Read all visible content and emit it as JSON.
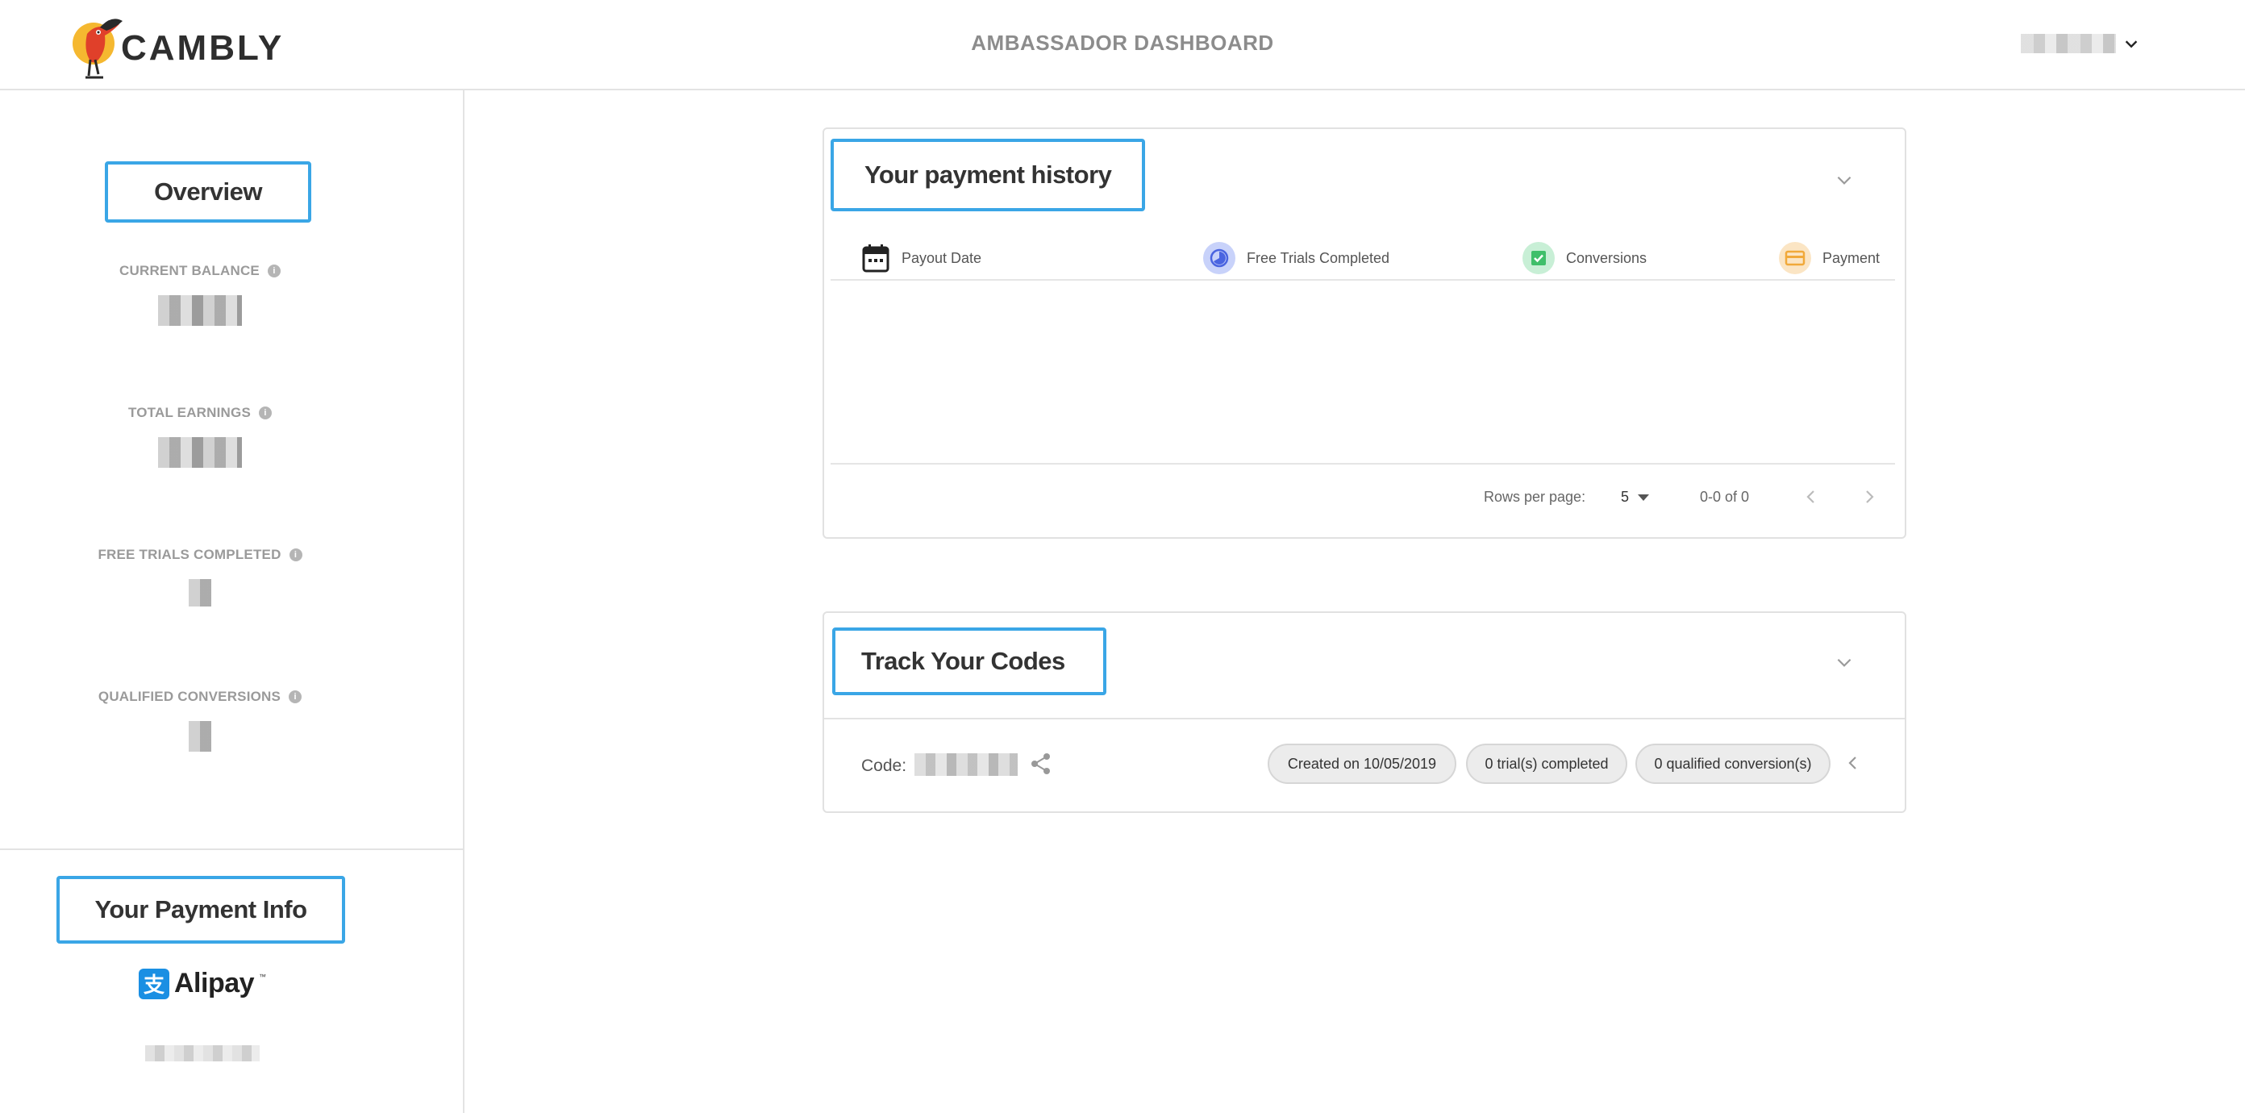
{
  "header": {
    "brand": "CAMBLY",
    "title": "AMBASSADOR DASHBOARD",
    "user_menu_icon": "chevron-down-icon"
  },
  "sidebar": {
    "overview_title": "Overview",
    "stats": [
      {
        "label": "CURRENT BALANCE",
        "icon": "info-icon"
      },
      {
        "label": "TOTAL EARNINGS",
        "icon": "info-icon"
      },
      {
        "label": "FREE TRIALS COMPLETED",
        "icon": "info-icon"
      },
      {
        "label": "QUALIFIED CONVERSIONS",
        "icon": "info-icon"
      }
    ],
    "payment_info_title": "Your Payment Info",
    "payment_method": "Alipay",
    "payment_method_tm": "™"
  },
  "payment_history": {
    "title": "Your payment history",
    "columns": [
      {
        "label": "Payout Date",
        "icon": "calendar-icon"
      },
      {
        "label": "Free Trials Completed",
        "icon": "trial-icon"
      },
      {
        "label": "Conversions",
        "icon": "check-icon"
      },
      {
        "label": "Payment",
        "icon": "card-icon"
      }
    ],
    "rows": [],
    "rows_per_page_label": "Rows per page:",
    "rows_per_page_value": "5",
    "range_text": "0-0 of 0"
  },
  "track_codes": {
    "title": "Track Your Codes",
    "code_label": "Code:",
    "chips": [
      "Created on 10/05/2019",
      "0 trial(s) completed",
      "0 qualified conversion(s)"
    ]
  },
  "colors": {
    "highlight": "#3aa6e6",
    "trial_icon_bg": "#c8d2fa",
    "conversions_icon_bg": "#c8efd6",
    "payment_icon_bg": "#fbe5c4",
    "alipay_blue": "#1a8fe3"
  }
}
